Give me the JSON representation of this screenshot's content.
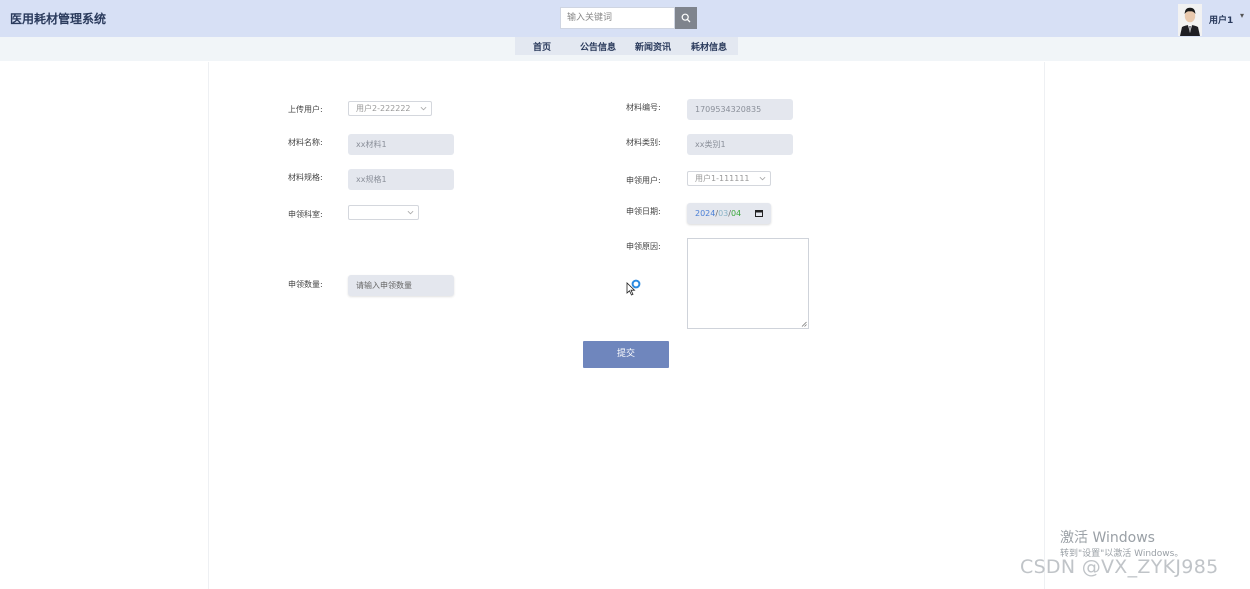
{
  "header": {
    "app_title": "医用耗材管理系统",
    "search_placeholder": "输入关键词",
    "user_name": "用户1",
    "user_caret": "▾"
  },
  "nav": [
    "首页",
    "公告信息",
    "新闻资讯",
    "耗材信息"
  ],
  "form": {
    "upload_user": {
      "label": "上传用户:",
      "value": "用户2-222222"
    },
    "material_name": {
      "label": "材料名称:",
      "value": "xx材料1"
    },
    "material_spec": {
      "label": "材料规格:",
      "value": "xx规格1"
    },
    "dept": {
      "label": "申领科室:",
      "value": ""
    },
    "quantity": {
      "label": "申领数量:",
      "placeholder": "请输入申领数量"
    },
    "material_code": {
      "label": "材料编号:",
      "value": "1709534320835"
    },
    "material_type": {
      "label": "材料类别:",
      "value": "xx类别1"
    },
    "apply_user": {
      "label": "申领用户:",
      "value": "用户1-111111"
    },
    "apply_date": {
      "label": "申领日期:",
      "year": "2024",
      "month": "03",
      "day": "04",
      "sep": "/"
    },
    "reason": {
      "label": "申领原因:",
      "value": ""
    },
    "submit_label": "提交"
  },
  "overlay": {
    "activate_title": "激活 Windows",
    "activate_sub": "转到\"设置\"以激活 Windows。",
    "csdn": "CSDN @VX_ZYKJ985"
  },
  "colors": {
    "header_bg": "#d7e0f5",
    "submit_bg": "#6f86bd",
    "year_color": "#4a7fd6",
    "month_color": "#8ab4c8",
    "day_color": "#3ba83b"
  }
}
